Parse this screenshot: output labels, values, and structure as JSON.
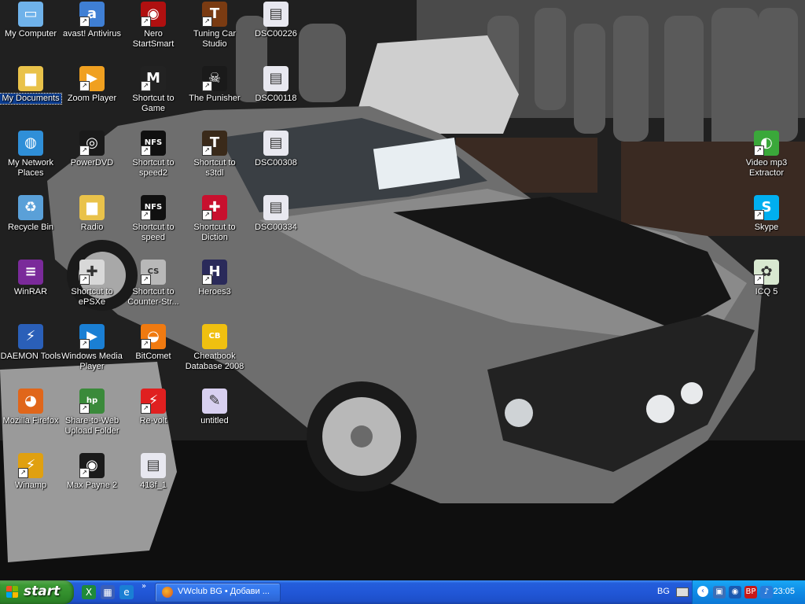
{
  "desktop_icons": [
    {
      "name": "my-computer-icon",
      "label": "My Computer",
      "shortcut": false,
      "color": "#6fb2ea",
      "glyph": "▭",
      "selected": false
    },
    {
      "name": "avast-antivirus-icon",
      "label": "avast! Antivirus",
      "shortcut": true,
      "color": "#3f7fd4",
      "glyph": "a",
      "selected": false
    },
    {
      "name": "nero-startsmart-icon",
      "label": "Nero StartSmart",
      "shortcut": true,
      "color": "#b01010",
      "glyph": "◉",
      "selected": false
    },
    {
      "name": "tuning-car-studio-icon",
      "label": "Tuning Car Studio",
      "shortcut": true,
      "color": "#7a3b12",
      "glyph": "T",
      "selected": false
    },
    {
      "name": "dsc00226-file-icon",
      "label": "DSC00226",
      "shortcut": false,
      "color": "#e8e8f0",
      "glyph": "▤",
      "selected": false
    },
    {
      "name": "my-documents-icon",
      "label": "My Documents",
      "shortcut": false,
      "color": "#e9c24a",
      "glyph": "▆",
      "selected": true
    },
    {
      "name": "zoom-player-icon",
      "label": "Zoom Player",
      "shortcut": true,
      "color": "#f0a020",
      "glyph": "▶",
      "selected": false
    },
    {
      "name": "mafia-game-icon",
      "label": "Shortcut to Game",
      "shortcut": true,
      "color": "#222222",
      "glyph": "M",
      "selected": false
    },
    {
      "name": "the-punisher-icon",
      "label": "The Punisher",
      "shortcut": true,
      "color": "#1a1a1a",
      "glyph": "☠",
      "selected": false
    },
    {
      "name": "dsc00118-file-icon",
      "label": "DSC00118",
      "shortcut": false,
      "color": "#e8e8f0",
      "glyph": "▤",
      "selected": false
    },
    {
      "name": "my-network-places-icon",
      "label": "My Network Places",
      "shortcut": false,
      "color": "#2f8fd8",
      "glyph": "◍",
      "selected": false
    },
    {
      "name": "powerdvd-icon",
      "label": "PowerDVD",
      "shortcut": true,
      "color": "#1a1a1a",
      "glyph": "◎",
      "selected": false
    },
    {
      "name": "nfs-speed2-icon",
      "label": "Shortcut to speed2",
      "shortcut": true,
      "color": "#101010",
      "glyph": "NFS",
      "selected": false
    },
    {
      "name": "s3tdl-icon",
      "label": "Shortcut to s3tdl",
      "shortcut": true,
      "color": "#3a2a1a",
      "glyph": "T",
      "selected": false
    },
    {
      "name": "dsc00308-file-icon",
      "label": "DSC00308",
      "shortcut": false,
      "color": "#e8e8f0",
      "glyph": "▤",
      "selected": false
    },
    {
      "name": "recycle-bin-icon",
      "label": "Recycle Bin",
      "shortcut": false,
      "color": "#5aa0d8",
      "glyph": "♻",
      "selected": false
    },
    {
      "name": "radio-folder-icon",
      "label": "Radio",
      "shortcut": false,
      "color": "#e9c24a",
      "glyph": "▆",
      "selected": false
    },
    {
      "name": "nfs-speed-icon",
      "label": "Shortcut to speed",
      "shortcut": true,
      "color": "#101010",
      "glyph": "NFS",
      "selected": false
    },
    {
      "name": "diction-icon",
      "label": "Shortcut to Diction",
      "shortcut": true,
      "color": "#c8102e",
      "glyph": "✚",
      "selected": false
    },
    {
      "name": "dsc00334-file-icon",
      "label": "DSC00334",
      "shortcut": false,
      "color": "#e8e8f0",
      "glyph": "▤",
      "selected": false
    },
    {
      "name": "winrar-icon",
      "label": "WinRAR",
      "shortcut": false,
      "color": "#7a2a9a",
      "glyph": "≡",
      "selected": false
    },
    {
      "name": "epsxe-icon",
      "label": "Shortcut to ePSXe",
      "shortcut": true,
      "color": "#d8d8d8",
      "glyph": "✚",
      "selected": false
    },
    {
      "name": "counter-strike-icon",
      "label": "Shortcut to Counter-Str...",
      "shortcut": true,
      "color": "#b8b8b8",
      "glyph": "CS",
      "selected": false
    },
    {
      "name": "heroes3-icon",
      "label": "Heroes3",
      "shortcut": true,
      "color": "#2a2a5a",
      "glyph": "H",
      "selected": false
    },
    {
      "name": "video-mp3-extractor-icon",
      "label": "Video mp3 Extractor",
      "shortcut": true,
      "color": "#3aa83a",
      "glyph": "◐",
      "selected": false
    },
    {
      "name": "skype-icon",
      "label": "Skype",
      "shortcut": true,
      "color": "#00aff0",
      "glyph": "S",
      "selected": false
    },
    {
      "name": "icq-icon",
      "label": "ICQ 5",
      "shortcut": true,
      "color": "#d8e8d0",
      "glyph": "✿",
      "selected": false
    },
    {
      "name": "daemon-tools-icon",
      "label": "DAEMON Tools",
      "shortcut": false,
      "color": "#2a5fb8",
      "glyph": "⚡",
      "selected": false
    },
    {
      "name": "windows-media-player-icon",
      "label": "Windows Media Player",
      "shortcut": true,
      "color": "#1a7fd4",
      "glyph": "▶",
      "selected": false
    },
    {
      "name": "bitcomet-icon",
      "label": "BitComet",
      "shortcut": true,
      "color": "#f07a10",
      "glyph": "◒",
      "selected": false
    },
    {
      "name": "cheatbook-icon",
      "label": "Cheatbook Database 2008",
      "shortcut": false,
      "color": "#f0c010",
      "glyph": "CB",
      "selected": false
    },
    {
      "name": "mozilla-firefox-icon",
      "label": "Mozilla Firefox",
      "shortcut": false,
      "color": "#e0661a",
      "glyph": "◕",
      "selected": false
    },
    {
      "name": "share-to-web-icon",
      "label": "Share-to-Web Upload Folder",
      "shortcut": true,
      "color": "#3a8a3a",
      "glyph": "hp",
      "selected": false
    },
    {
      "name": "re-volt-icon",
      "label": "Re-volt",
      "shortcut": true,
      "color": "#e02020",
      "glyph": "⚡",
      "selected": false
    },
    {
      "name": "untitled-paint-icon",
      "label": "untitled",
      "shortcut": false,
      "color": "#d8d0f0",
      "glyph": "✎",
      "selected": false
    },
    {
      "name": "winamp-icon",
      "label": "Winamp",
      "shortcut": true,
      "color": "#e0a010",
      "glyph": "⚡",
      "selected": false
    },
    {
      "name": "max-payne-2-icon",
      "label": "Max Payne 2",
      "shortcut": true,
      "color": "#1a1a1a",
      "glyph": "◉",
      "selected": false
    },
    {
      "name": "413f-1-file-icon",
      "label": "413f_1",
      "shortcut": false,
      "color": "#e8e8f0",
      "glyph": "▤",
      "selected": false
    }
  ],
  "taskbar": {
    "start_label": "start",
    "task_window_title": "VWclub BG • Добави ...",
    "quick_launch": [
      {
        "name": "show-desktop-icon",
        "glyph": "X",
        "color": "#1f8a3a"
      },
      {
        "name": "media-quicklaunch-icon",
        "glyph": "▦",
        "color": "#3a5fb8"
      },
      {
        "name": "internet-explorer-icon",
        "glyph": "e",
        "color": "#1a7fd4"
      }
    ],
    "quick_launch_more": "»",
    "language": "BG",
    "tray_icons": [
      {
        "name": "network-tray-icon",
        "glyph": "▣",
        "color": "#3a6fb8"
      },
      {
        "name": "shield-tray-icon",
        "glyph": "◉",
        "color": "#1a5ab0"
      },
      {
        "name": "bp-tray-icon",
        "glyph": "BP",
        "color": "#c81818"
      },
      {
        "name": "volume-tray-icon",
        "glyph": "♪",
        "color": "#2a7ad8"
      }
    ],
    "clock": "23:05"
  }
}
